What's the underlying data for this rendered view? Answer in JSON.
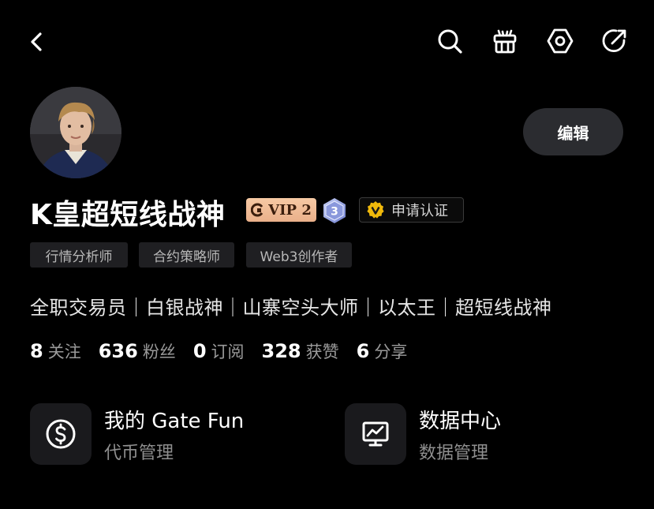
{
  "topbar": {
    "back_icon": "chevron-left-icon",
    "icons": [
      "search-icon",
      "gift-icon",
      "hexagon-settings-icon",
      "share-icon"
    ]
  },
  "profile": {
    "name": "K皇超短线战神",
    "edit_label": "编辑",
    "vip_label": "VIP 2",
    "level": "3",
    "verify_label": "申请认证",
    "tags": [
      "行情分析师",
      "合约策略师",
      "Web3创作者"
    ],
    "bio": "全职交易员｜白银战神｜山寨空头大师｜以太王｜超短线战神"
  },
  "stats": [
    {
      "value": "8",
      "label": "关注"
    },
    {
      "value": "636",
      "label": "粉丝"
    },
    {
      "value": "0",
      "label": "订阅"
    },
    {
      "value": "328",
      "label": "获赞"
    },
    {
      "value": "6",
      "label": "分享"
    }
  ],
  "cards": [
    {
      "title": "我的 Gate Fun",
      "subtitle": "代币管理",
      "icon": "dollar-coin-icon"
    },
    {
      "title": "数据中心",
      "subtitle": "数据管理",
      "icon": "chart-monitor-icon"
    }
  ],
  "colors": {
    "background": "#000000",
    "vip_badge": "#eab08a",
    "verify_badge": "#f0b90b",
    "level_badge": "#7f8fd8"
  }
}
